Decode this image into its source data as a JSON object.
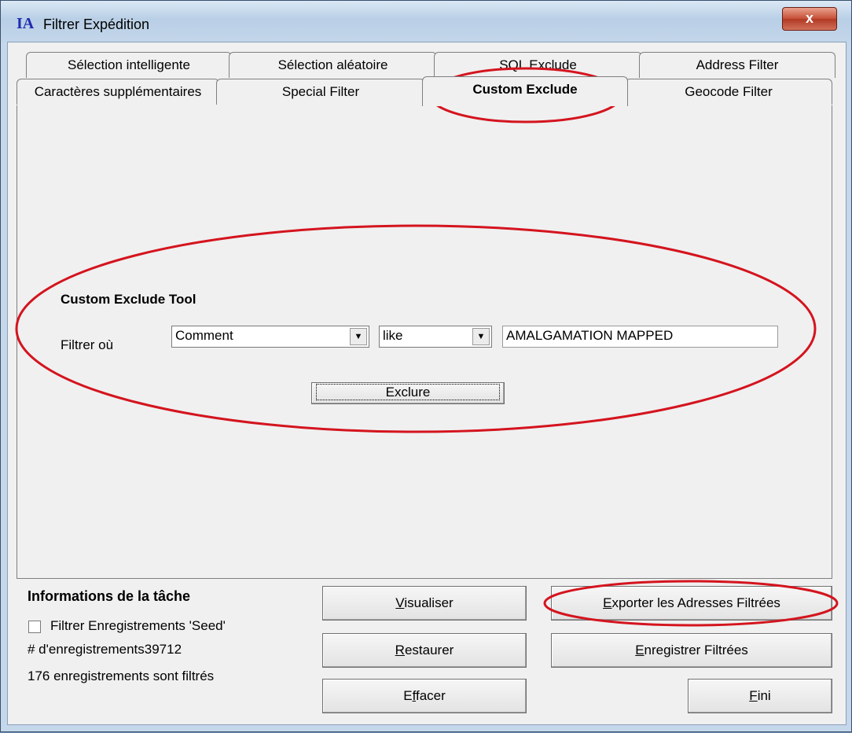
{
  "window": {
    "app_icon": "IA",
    "title": "Filtrer Expédition",
    "close_label": "x"
  },
  "tabs_row1": [
    {
      "label": "Sélection intelligente"
    },
    {
      "label": "Sélection aléatoire"
    },
    {
      "label": "SQL Exclude"
    },
    {
      "label": "Address Filter"
    }
  ],
  "tabs_row2": [
    {
      "label": "Caractères supplémentaires"
    },
    {
      "label": "Special Filter"
    },
    {
      "label": "Custom Exclude",
      "active": true
    },
    {
      "label": "Geocode Filter"
    }
  ],
  "custom_exclude": {
    "heading": "Custom Exclude Tool",
    "filter_label": "Filtrer où",
    "field_select": "Comment",
    "operator_select": "like",
    "value_input": "AMALGAMATION MAPPED",
    "exclude_button": "Exclure"
  },
  "task_info": {
    "heading": "Informations de la tâche",
    "seed_checkbox_label": "Filtrer Enregistrements 'Seed'",
    "seed_checked": false,
    "record_count": "# d'enregistrements39712",
    "filtered_status": "176 enregistrements sont filtrés"
  },
  "buttons": {
    "visualiser": {
      "pre": "",
      "ul": "V",
      "post": "isualiser"
    },
    "restaurer": {
      "pre": "",
      "ul": "R",
      "post": "estaurer"
    },
    "effacer": {
      "pre": "E",
      "ul": "f",
      "post": "facer"
    },
    "exporter": {
      "pre": "",
      "ul": "E",
      "post": "xporter les Adresses Filtrées"
    },
    "enregistrer": {
      "pre": "",
      "ul": "E",
      "post": "nregistrer Filtrées"
    },
    "fini": {
      "pre": "",
      "ul": "F",
      "post": "ini"
    }
  },
  "colors": {
    "highlight_oval": "#d4141e"
  },
  "icons": {
    "dropdown": "chevron-down-icon",
    "close": "close-icon"
  }
}
